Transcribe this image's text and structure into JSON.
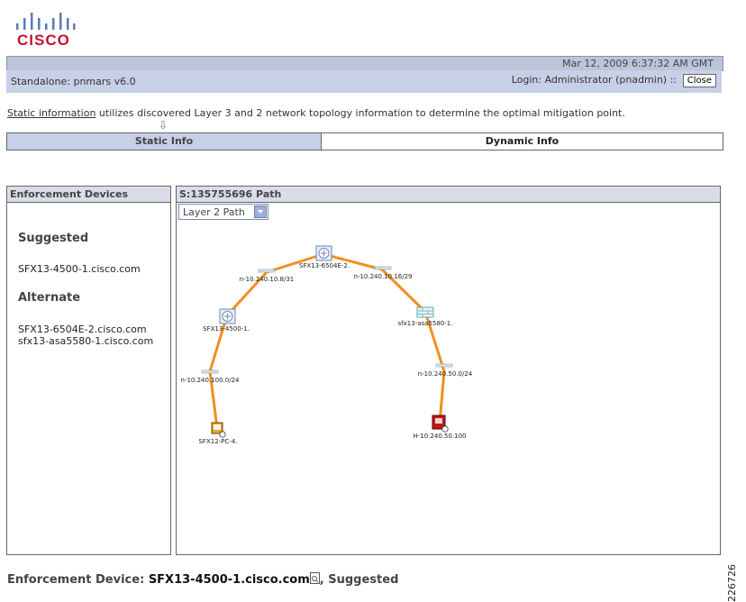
{
  "logo": {
    "text": "CISCO"
  },
  "header": {
    "datetime": "Mar 12, 2009 6:37:32 AM GMT",
    "standalone": "Standalone: pnmars v6.0",
    "login": "Login: Administrator (pnadmin)  ::",
    "close_label": "Close"
  },
  "info": {
    "link_text": "Static information",
    "rest_text": " utilizes discovered Layer 3 and 2 network topology information to determine the optimal mitigation point."
  },
  "tabs": {
    "static_label": "Static Info",
    "dynamic_label": "Dynamic Info"
  },
  "enforcement_panel": {
    "title": "Enforcement Devices",
    "suggested_heading": "Suggested",
    "suggested_devices": [
      "SFX13-4500-1.cisco.com"
    ],
    "alternate_heading": "Alternate",
    "alternate_devices": [
      "SFX13-6504E-2.cisco.com",
      "sfx13-asa5580-1.cisco.com"
    ]
  },
  "path_panel": {
    "title_prefix": "S:135755696",
    "title_suffix": " Path",
    "layer_select_value": "Layer 2 Path",
    "nodes": {
      "router_top": "SFX13-6504E-2.",
      "router_left": "SFX13-4500-1.",
      "firewall": "sfx13-asa5580-1.",
      "pc": "SFX12-PC-4.",
      "host": "H-10.240.50.100",
      "net_a": "n-10.240.10.8/31",
      "net_b": "n-10.240.10.16/29",
      "net_c": "n-10.240.100.0/24",
      "net_d": "n-10.240.50.0/24"
    }
  },
  "footer": {
    "prefix": "Enforcement Device: ",
    "device": "SFX13-4500-1.cisco.com",
    "suffix": ", Suggested"
  },
  "side_number": "226726",
  "colors": {
    "brand": "#c8102e",
    "band": "#c7d0e6",
    "link": "#f0901e"
  }
}
